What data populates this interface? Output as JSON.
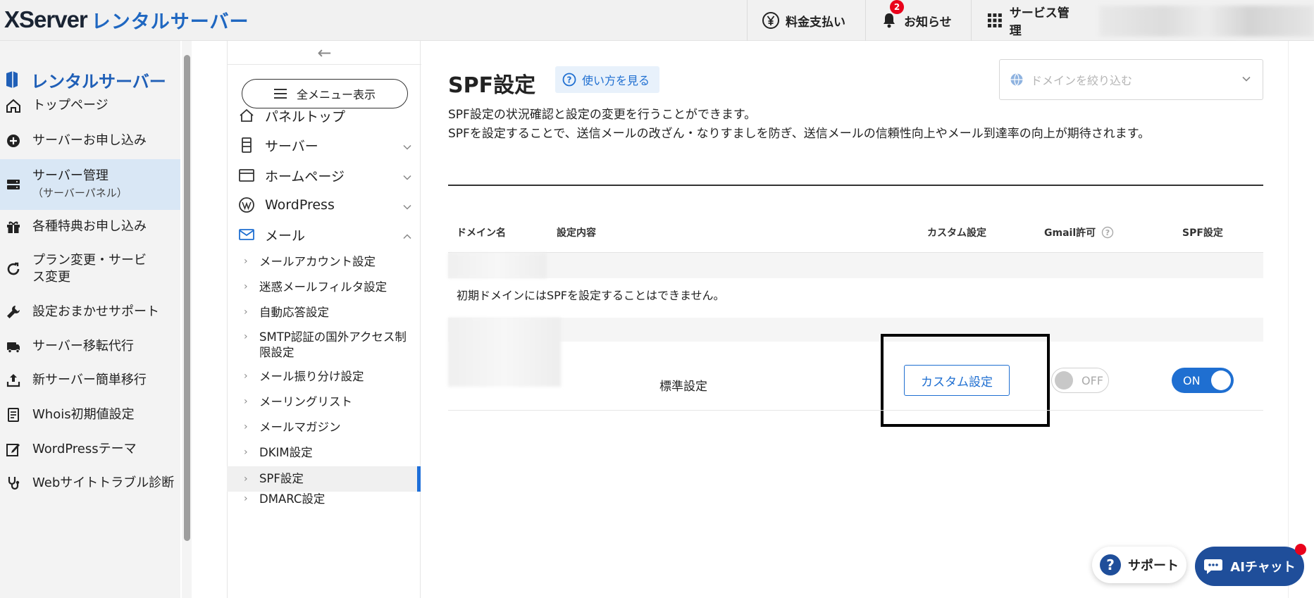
{
  "header": {
    "logo_main": "XServer",
    "logo_sub": "レンタルサーバー",
    "payment_label": "料金支払い",
    "notice_label": "お知らせ",
    "notice_badge": "2",
    "service_label": "サービス管理"
  },
  "left_sidebar": {
    "title": "レンタルサーバー",
    "items": [
      {
        "label": "トップページ",
        "icon": "home-icon"
      },
      {
        "label": "サーバーお申し込み",
        "icon": "plus-circle-icon"
      },
      {
        "label": "サーバー管理",
        "sub": "（サーバーパネル）",
        "icon": "server-icon"
      },
      {
        "label": "各種特典お申し込み",
        "icon": "gift-icon"
      },
      {
        "label": "プラン変更・サービス変更",
        "icon": "refresh-icon"
      },
      {
        "label": "設定おまかせサポート",
        "icon": "wrench-icon"
      },
      {
        "label": "サーバー移転代行",
        "icon": "truck-icon"
      },
      {
        "label": "新サーバー簡単移行",
        "icon": "upload-icon"
      },
      {
        "label": "Whois初期値設定",
        "icon": "document-icon"
      },
      {
        "label": "WordPressテーマ",
        "icon": "edit-icon"
      },
      {
        "label": "Webサイトトラブル診断",
        "icon": "stethoscope-icon"
      }
    ]
  },
  "panel_menu": {
    "all_menu_label": "全メニュー表示",
    "items": [
      {
        "label": "パネルトップ"
      },
      {
        "label": "サーバー"
      },
      {
        "label": "ホームページ"
      },
      {
        "label": "WordPress"
      },
      {
        "label": "メール"
      }
    ],
    "mail_sub": [
      {
        "label": "メールアカウント設定"
      },
      {
        "label": "迷惑メールフィルタ設定"
      },
      {
        "label": "自動応答設定"
      },
      {
        "label": "SMTP認証の国外アクセス制限設定"
      },
      {
        "label": "メール振り分け設定"
      },
      {
        "label": "メーリングリスト"
      },
      {
        "label": "メールマガジン"
      },
      {
        "label": "DKIM設定"
      },
      {
        "label": "SPF設定"
      },
      {
        "label": "DMARC設定"
      }
    ]
  },
  "main": {
    "title": "SPF設定",
    "howto_label": "使い方を見る",
    "domain_placeholder": "ドメインを絞り込む",
    "desc_line1": "SPF設定の状況確認と設定の変更を行うことができます。",
    "desc_line2": "SPFを設定することで、送信メールの改ざん・なりすましを防ぎ、送信メールの信頼性向上やメール到達率の向上が期待されます。",
    "columns": [
      "ドメイン名",
      "設定内容",
      "カスタム設定",
      "Gmail許可",
      "SPF設定"
    ],
    "note": "初期ドメインにはSPFを設定することはできません。",
    "row": {
      "setting": "標準設定",
      "custom_button": "カスタム設定",
      "gmail_toggle": "OFF",
      "spf_toggle": "ON"
    }
  },
  "floating": {
    "support_label": "サポート",
    "ai_label": "AIチャット"
  }
}
